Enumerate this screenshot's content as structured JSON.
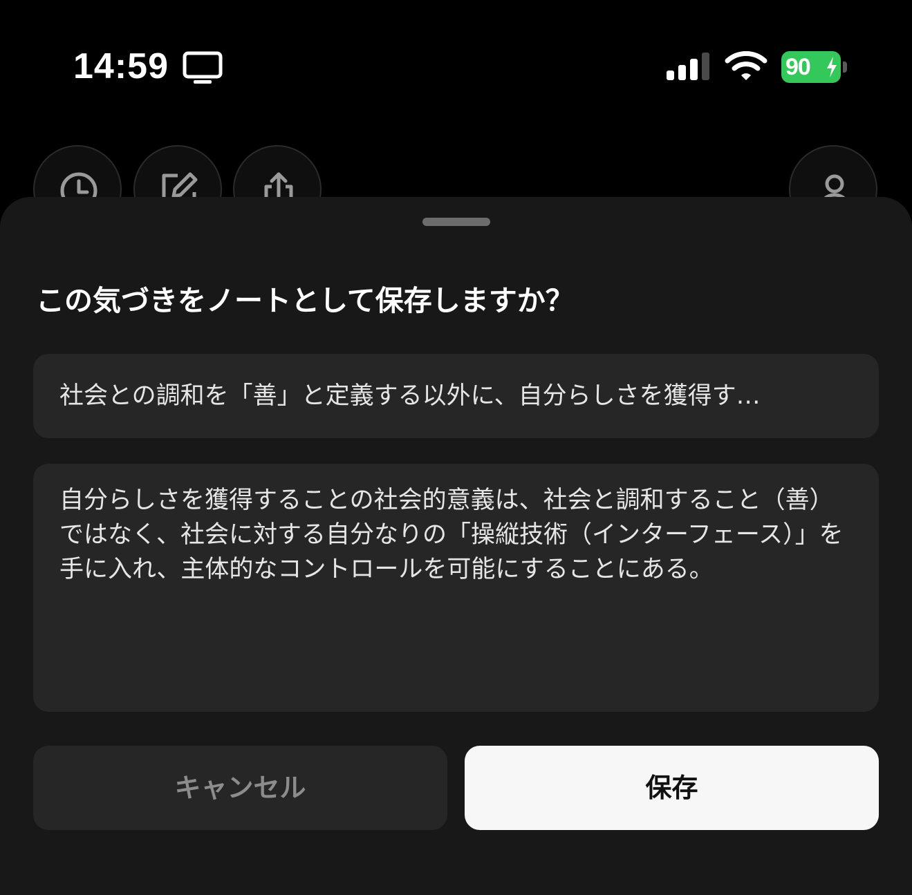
{
  "status_bar": {
    "time": "14:59",
    "battery_level": "90",
    "battery_color": "#34c759",
    "icons": [
      "screen-mirroring-icon",
      "cellular-signal-icon",
      "wifi-icon",
      "battery-charging-icon"
    ]
  },
  "toolbar": {
    "icons": [
      "history-clock-icon",
      "compose-icon",
      "share-icon",
      "profile-icon"
    ]
  },
  "sheet": {
    "title": "この気づきをノートとして保存しますか？",
    "note_title_value": "社会との調和を「善」と定義する以外に、自分らしさを獲得す…",
    "note_body_value": "自分らしさを獲得することの社会的意義は、社会と調和すること（善）ではなく、社会に対する自分なりの「操縦技術（インターフェース）」を手に入れ、主体的なコントロールを可能にすることにある。",
    "cancel_label": "キャンセル",
    "save_label": "保存"
  }
}
